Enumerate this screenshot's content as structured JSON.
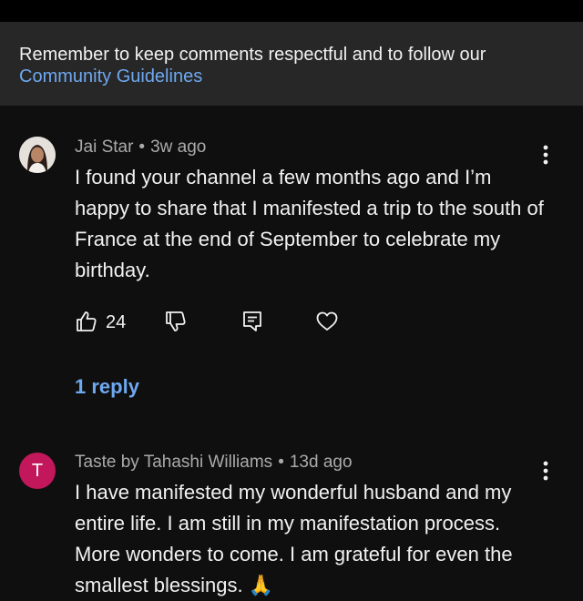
{
  "notice": {
    "text": "Remember to keep comments respectful and to follow our",
    "link": "Community Guidelines"
  },
  "comments": [
    {
      "author": "Jai Star",
      "time": "3w ago",
      "text": "I found your channel a few months ago and I’m happy to share that I manifested a trip to the south of France at the end of September to celebrate my birthday.",
      "likes": "24",
      "replies_label": "1 reply",
      "avatar": "profile-photo"
    },
    {
      "author": "Taste by Tahashi Williams",
      "time": "13d ago",
      "text": "I have manifested my wonderful husband and my entire life. I am still in my manifestation process. More wonders to come. I am grateful for even the smallest blessings. 🙏",
      "avatar_letter": "T",
      "avatar_color": "#c2185b"
    }
  ],
  "meta_separator": "•",
  "colors": {
    "background": "#0f0f0f",
    "notice_bg": "#272727",
    "link": "#6ea8f0",
    "secondary_text": "#aaaaaa"
  }
}
